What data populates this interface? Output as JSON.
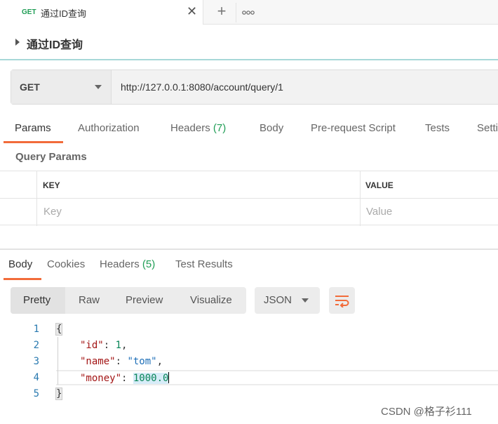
{
  "tab": {
    "method": "GET",
    "name": "通过ID查询",
    "close": "✕",
    "new": "+",
    "more_icon": "more-icon"
  },
  "title": "通过ID查询",
  "url_bar": {
    "method": "GET",
    "url": "http://127.0.0.1:8080/account/query/1"
  },
  "request_tabs": [
    {
      "label": "Params",
      "count": ""
    },
    {
      "label": "Authorization",
      "count": ""
    },
    {
      "label": "Headers",
      "count": "(7)"
    },
    {
      "label": "Body",
      "count": ""
    },
    {
      "label": "Pre-request Script",
      "count": ""
    },
    {
      "label": "Tests",
      "count": ""
    },
    {
      "label": "Setti",
      "count": ""
    }
  ],
  "query_params": {
    "label": "Query Params",
    "key_header": "KEY",
    "value_header": "VALUE",
    "key_placeholder": "Key",
    "value_placeholder": "Value"
  },
  "response_tabs": [
    {
      "label": "Body",
      "count": ""
    },
    {
      "label": "Cookies",
      "count": ""
    },
    {
      "label": "Headers",
      "count": "(5)"
    },
    {
      "label": "Test Results",
      "count": ""
    }
  ],
  "view_modes": [
    "Pretty",
    "Raw",
    "Preview",
    "Visualize"
  ],
  "format": "JSON",
  "code": {
    "line_numbers": [
      "1",
      "2",
      "3",
      "4",
      "5"
    ],
    "open_brace": "{",
    "close_brace": "}",
    "fields": [
      {
        "key": "\"id\"",
        "sep": ": ",
        "value": "1",
        "comma": ","
      },
      {
        "key": "\"name\"",
        "sep": ": ",
        "value": "\"tom\"",
        "comma": ","
      },
      {
        "key": "\"money\"",
        "sep": ": ",
        "value": "1000.0",
        "comma": ""
      }
    ]
  },
  "watermark": "CSDN @格子衫111",
  "colors": {
    "accent": "#f26b3a",
    "count_green": "#1f9d55",
    "method_green": "#1f9d55"
  }
}
